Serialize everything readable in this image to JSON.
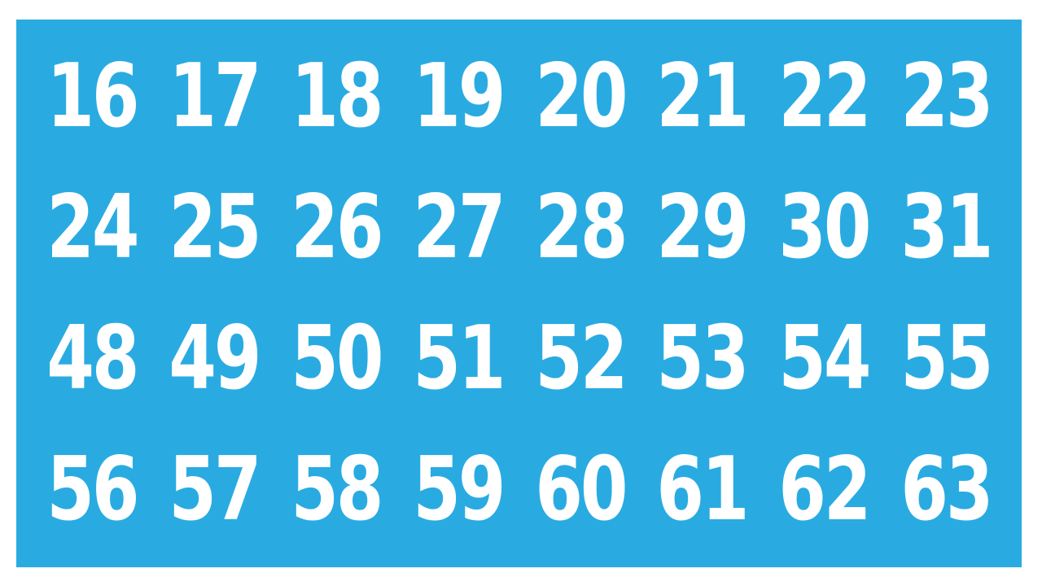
{
  "card": {
    "background_color": "#29abe2",
    "text_color": "#ffffff",
    "rows": [
      [
        "16",
        "17",
        "18",
        "19",
        "20",
        "21",
        "22",
        "23"
      ],
      [
        "24",
        "25",
        "26",
        "27",
        "28",
        "29",
        "30",
        "31"
      ],
      [
        "48",
        "49",
        "50",
        "51",
        "52",
        "53",
        "54",
        "55"
      ],
      [
        "56",
        "57",
        "58",
        "59",
        "60",
        "61",
        "62",
        "63"
      ]
    ]
  }
}
